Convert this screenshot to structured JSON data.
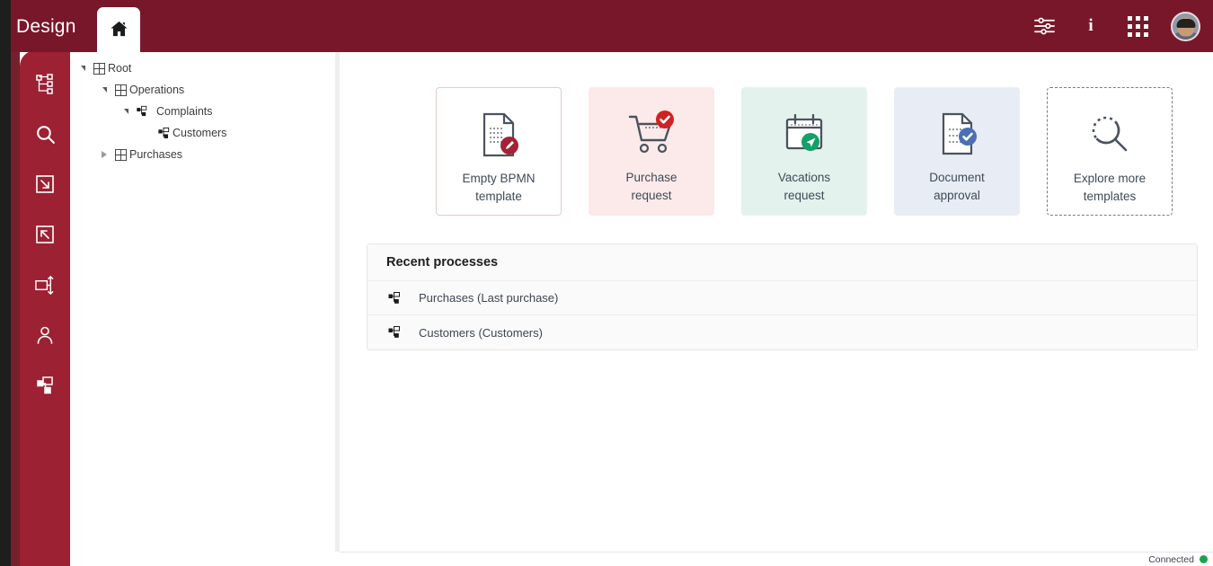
{
  "header": {
    "app_title": "Design",
    "home_tab_icon": "home-icon",
    "actions": [
      {
        "name": "settings-sliders-icon",
        "label": "Settings"
      },
      {
        "name": "info-icon",
        "label": "i"
      },
      {
        "name": "apps-grid-icon",
        "label": "Apps"
      },
      {
        "name": "user-avatar",
        "label": "Account"
      }
    ]
  },
  "rail": {
    "items": [
      {
        "name": "hierarchy-tree-icon",
        "label": "Model tree"
      },
      {
        "name": "search-icon",
        "label": "Search"
      },
      {
        "name": "import-icon",
        "label": "Import"
      },
      {
        "name": "export-icon",
        "label": "Export"
      },
      {
        "name": "process-pool-icon",
        "label": "Pools"
      },
      {
        "name": "user-icon",
        "label": "Users"
      },
      {
        "name": "subprocess-icon",
        "label": "Processes"
      }
    ]
  },
  "tree": {
    "nodes": [
      {
        "label": "Root",
        "indent": 0,
        "state": "expanded",
        "icon": "folder-grid-icon"
      },
      {
        "label": "Operations",
        "indent": 1,
        "state": "expanded",
        "icon": "folder-grid-icon"
      },
      {
        "label": "Complaints",
        "indent": 2,
        "state": "expanded",
        "icon": "process-icon"
      },
      {
        "label": "Customers",
        "indent": 3,
        "state": "leaf",
        "icon": "subprocess-icon"
      },
      {
        "label": "Purchases",
        "indent": 1,
        "state": "collapsed",
        "icon": "folder-grid-icon"
      }
    ]
  },
  "templates": {
    "cards": [
      {
        "title": "Empty BPMN\ntemplate",
        "icon": "document-pencil-icon",
        "bg": "#ffffff",
        "border": "#e9c9ca"
      },
      {
        "title": "Purchase\nrequest",
        "icon": "shopping-cart-check-icon",
        "bg": "#fbeae9",
        "border": "none"
      },
      {
        "title": "Vacations\nrequest",
        "icon": "calendar-send-icon",
        "bg": "#e3f2ec",
        "border": "none"
      },
      {
        "title": "Document\napproval",
        "icon": "document-check-icon",
        "bg": "#e8edf5",
        "border": "none"
      },
      {
        "title": "Explore more\ntemplates",
        "icon": "magnifier-icon",
        "bg": "#ffffff",
        "border": "dashed"
      }
    ]
  },
  "recent": {
    "heading": "Recent processes",
    "rows": [
      {
        "label": "Purchases (Last purchase)",
        "icon": "subprocess-icon"
      },
      {
        "label": "Customers (Customers)",
        "icon": "subprocess-icon"
      }
    ]
  },
  "status": {
    "connection_label": "Connected",
    "connection_color": "#19a44b"
  },
  "colors": {
    "header_red": "#781729",
    "rail_crimson": "#9c2133",
    "rail_dark_red": "#76202c",
    "rail_black": "#1e1e1e"
  }
}
